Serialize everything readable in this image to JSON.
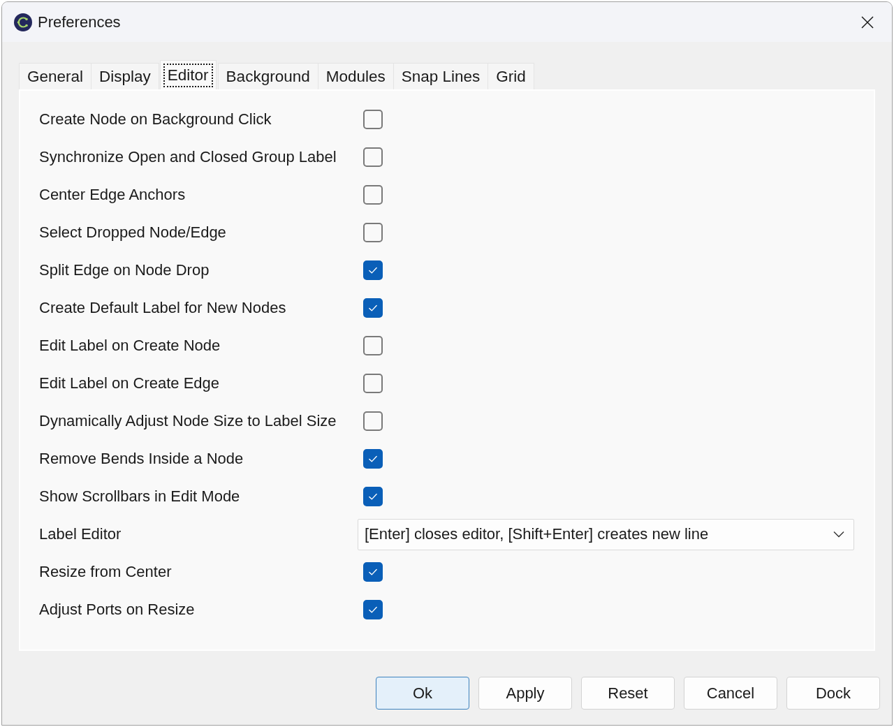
{
  "window": {
    "title": "Preferences"
  },
  "tabs": [
    {
      "label": "General",
      "selected": false
    },
    {
      "label": "Display",
      "selected": false
    },
    {
      "label": "Editor",
      "selected": true
    },
    {
      "label": "Background",
      "selected": false
    },
    {
      "label": "Modules",
      "selected": false
    },
    {
      "label": "Snap Lines",
      "selected": false
    },
    {
      "label": "Grid",
      "selected": false
    }
  ],
  "settings": [
    {
      "kind": "checkbox",
      "label": "Create Node on Background Click",
      "checked": false
    },
    {
      "kind": "checkbox",
      "label": "Synchronize Open and Closed Group Label",
      "checked": false
    },
    {
      "kind": "checkbox",
      "label": "Center Edge Anchors",
      "checked": false
    },
    {
      "kind": "checkbox",
      "label": "Select Dropped Node/Edge",
      "checked": false
    },
    {
      "kind": "checkbox",
      "label": "Split Edge on Node Drop",
      "checked": true
    },
    {
      "kind": "checkbox",
      "label": "Create Default Label for New Nodes",
      "checked": true
    },
    {
      "kind": "checkbox",
      "label": "Edit Label on Create Node",
      "checked": false
    },
    {
      "kind": "checkbox",
      "label": "Edit Label on Create Edge",
      "checked": false
    },
    {
      "kind": "checkbox",
      "label": "Dynamically Adjust Node Size to Label Size",
      "checked": false
    },
    {
      "kind": "checkbox",
      "label": "Remove Bends Inside a Node",
      "checked": true
    },
    {
      "kind": "checkbox",
      "label": "Show Scrollbars in Edit Mode",
      "checked": true
    },
    {
      "kind": "dropdown",
      "label": "Label Editor",
      "value": "[Enter] closes editor, [Shift+Enter] creates new line"
    },
    {
      "kind": "checkbox",
      "label": "Resize from Center",
      "checked": true
    },
    {
      "kind": "checkbox",
      "label": "Adjust Ports on Resize",
      "checked": true
    }
  ],
  "buttons": [
    {
      "label": "Ok",
      "default": true
    },
    {
      "label": "Apply",
      "default": false
    },
    {
      "label": "Reset",
      "default": false
    },
    {
      "label": "Cancel",
      "default": false
    },
    {
      "label": "Dock",
      "default": false
    }
  ]
}
